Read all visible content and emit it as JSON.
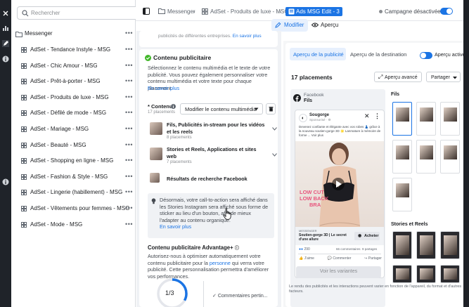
{
  "sidebar": {
    "search_placeholder": "Rechercher",
    "campaign": "Messenger",
    "adsets": [
      "AdSet - Tendance Instyle - MSG",
      "AdSet - Chic Amour - MSG",
      "AdSet - Prêt-à-porter - MSG",
      "AdSet - Produits de luxe - MSG",
      "AdSet - Défilé de mode - MSG",
      "AdSet - Mariage - MSG",
      "AdSet - Beauté - MSG",
      "AdSet - Shopping en ligne - MSG",
      "AdSet - Fashion & Style - MSG",
      "AdSet - Lingerie (habillement) - MSG",
      "AdSet - Vêtements pour femmes - MSG",
      "AdSet - Mode - MSG"
    ],
    "more": "•••"
  },
  "topbar": {
    "crumbs": [
      "Messenger",
      "AdSet - Produits de luxe - MSG"
    ],
    "active_crumb": "Ads MSG Edit - 3",
    "status": "Campagne désactivée",
    "modify": "Modifier",
    "preview": "Aperçu"
  },
  "editor": {
    "top_fragment": "publicités de différentes entreprises.",
    "top_fragment_link": "En savoir plus",
    "content_title": "Contenu publicitaire",
    "content_desc": "Sélectionnez le contenu multimédia et le texte de votre publicité. Vous pouvez également personnaliser votre contenu multimédia et votre texte pour chaque placement.",
    "content_link": "En savoir plus",
    "contenu_label": "* Contenu",
    "placements_count": "17 placements",
    "modify_media": "Modifier le contenu multimédia",
    "groups": [
      {
        "title": "Fils, Publicités in-stream pour les vidéos et les reels",
        "sub": "8 placements"
      },
      {
        "title": "Stories et Reels, Applications et sites web",
        "sub": "7 placements"
      },
      {
        "title": "Résultats de recherche Facebook",
        "sub": ""
      }
    ],
    "notice": "Désormais, votre call-to-action sera affiché dans les Stories Instagram sera affiché sous forme de sticker au lieu d'un bouton, afin de mieux l'adapter au contenu organique.",
    "notice_link": "En savoir plus",
    "advantage_title": "Contenu publicitaire Advantage+",
    "advantage_desc_1": "Autorisez-nous à optimiser automatiquement votre contenu publicitaire pour la",
    "advantage_link": "personne",
    "advantage_desc_2": "qui verra votre publicité. Cette personnalisation permettra d'améliorer vos performances.",
    "progress": "1/3",
    "progress_value": 0.33,
    "comments": "Commentaires pertin..."
  },
  "preview": {
    "tab_ad": "Aperçu de la publicité",
    "tab_dest": "Aperçu de la destination",
    "toggle_label": "Aperçu activé",
    "placements": "17 placements",
    "advanced": "Aperçu avancé",
    "share": "Partager",
    "facebook": "Facebook",
    "fils": "Fils",
    "page_name": "Sougorge",
    "sponsored": "Sponsorisé · ⚙",
    "post_text": "Devenez confiante et élégante avec vos robes 👗 grâce à la nouveau soutien-gorge 3D 🌟 Lanmature à mémoire de forme ... Voir plus",
    "promo_1": "LOW CUT",
    "promo_2": "LOW BACK",
    "promo_3": "BRA",
    "cta_source": "MESSENGER",
    "product": "Soutien-gorge 3D | Le secret d'une allure",
    "cta": "Acheter",
    "reactions": "290",
    "comments": "66 commentaires",
    "shares": "9 partages",
    "like": "J'aime",
    "comment": "Commenter",
    "share_action": "Partager",
    "variants": "Voir les variantes",
    "thumbs_fils": "Fils",
    "thumbs_stories": "Stories et Reels",
    "disclaimer": "Le rendu des publicités et les interactions peuvent varier en fonction de l'appareil, du format et d'autres facteurs."
  },
  "colors": {
    "accent": "#1b74e4",
    "success": "#42b72a",
    "promo": "#e8547c",
    "rail": "#1f2329"
  }
}
